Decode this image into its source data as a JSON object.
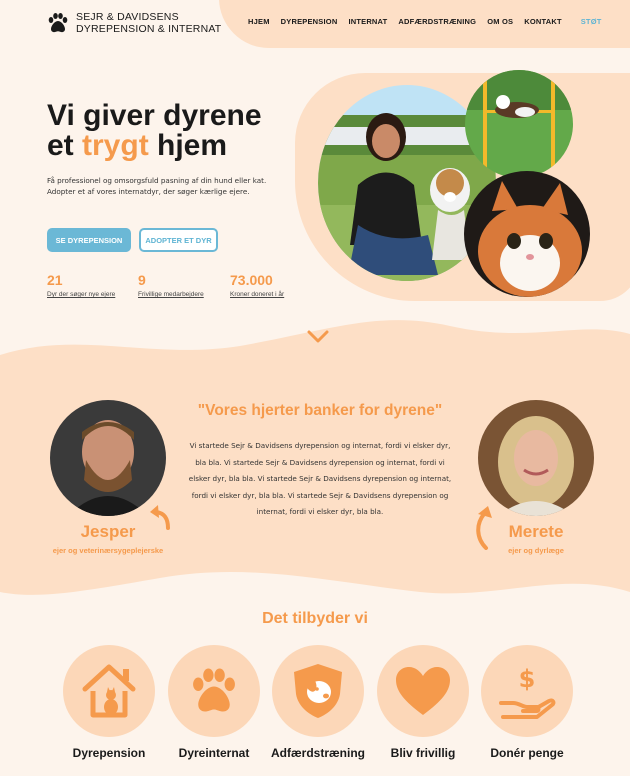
{
  "brand": {
    "line1": "SEJR & DAVIDSENS",
    "line2": "DYREPENSION & INTERNAT"
  },
  "nav": {
    "items": [
      "HJEM",
      "DYREPENSION",
      "INTERNAT",
      "ADFÆRDSTRÆNING",
      "OM OS",
      "KONTAKT"
    ],
    "support": "STØT"
  },
  "hero": {
    "title_line1": "Vi giver dyrene",
    "title_pre": "et ",
    "title_accent": "trygt",
    "title_post": " hjem",
    "lead": "Få professionel og omsorgsfuld pasning af din hund eller kat. Adopter et af vores internatdyr, der søger kærlige ejere.",
    "btn_primary": "SE DYREPENSION",
    "btn_secondary": "ADOPTER ET DYR",
    "stats": [
      {
        "value": "21",
        "label": "Dyr der søger nye ejere"
      },
      {
        "value": "9",
        "label": "Frivillige medarbejdere"
      },
      {
        "value": "73.000",
        "label": "Kroner doneret i år"
      }
    ]
  },
  "about": {
    "quote": "\"Vores hjerter banker for dyrene\"",
    "text": "Vi startede Sejr & Davidsens dyrepension og internat, fordi vi elsker dyr, bla bla. Vi startede Sejr & Davidsens dyrepension og internat, fordi vi elsker dyr, bla bla. Vi startede Sejr & Davidsens dyrepension og internat, fordi vi elsker dyr, bla bla. Vi startede Sejr & Davidsens dyrepension og internat, fordi vi elsker dyr, bla bla.",
    "person1": {
      "name": "Jesper",
      "role": "ejer og veterinærsygeplejerske"
    },
    "person2": {
      "name": "Merete",
      "role": "ejer og dyrlæge"
    }
  },
  "services": {
    "title": "Det tilbyder vi",
    "items": [
      "Dyrepension",
      "Dyreinternat",
      "Adfærdstræning",
      "Bliv frivillig",
      "Donér penge"
    ]
  },
  "colors": {
    "accent": "#f59a4c",
    "blue": "#6bb8d6",
    "peach": "#fddfc6",
    "bg": "#fdf4ec"
  }
}
